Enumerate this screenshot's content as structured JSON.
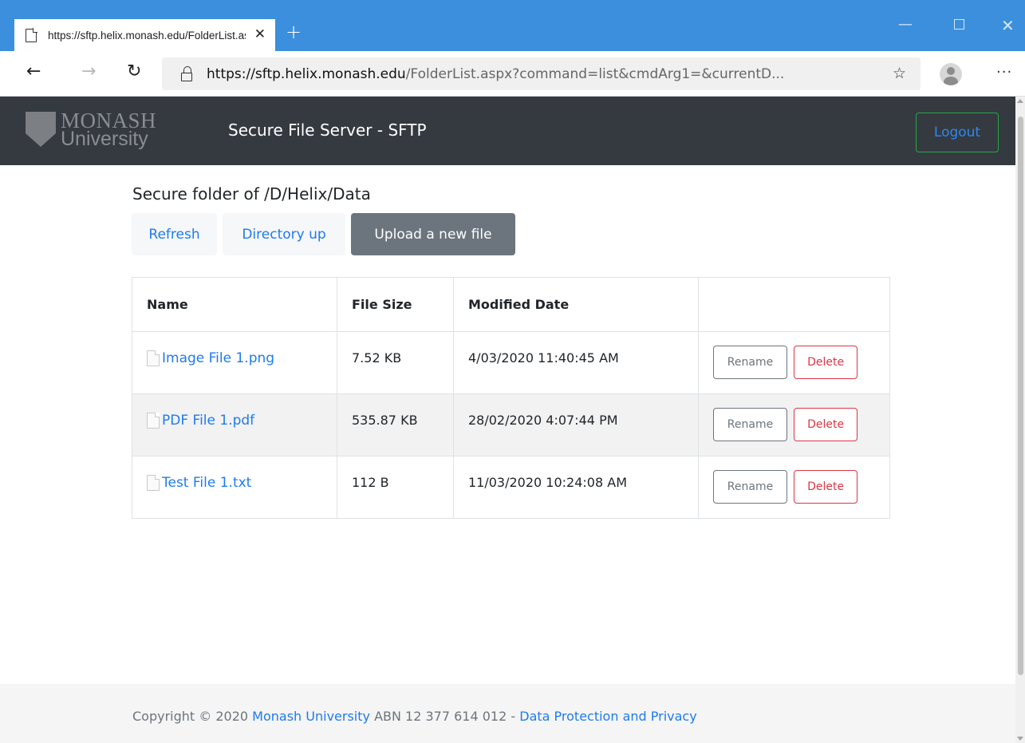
{
  "browser": {
    "tab_title": "https://sftp.helix.monash.edu/FolderList.aspx?",
    "tab_close": "✕",
    "new_tab": "+",
    "url_host": "https://sftp.helix.monash.edu",
    "url_path": "/FolderList.aspx?command=list&cmdArg1=&currentD...",
    "icons": {
      "back": "arrow-left-icon",
      "forward": "arrow-right-icon",
      "reload": "reload-icon",
      "lock": "lock-icon",
      "favorite": "star-icon",
      "profile": "profile-icon",
      "more": "more-icon"
    }
  },
  "navbar": {
    "logo_line1": "MONASH",
    "logo_line2": "University",
    "brand_title": "Secure File Server - SFTP",
    "logout_label": "Logout"
  },
  "main": {
    "heading": "Secure folder of /D/Helix/Data",
    "refresh_label": "Refresh",
    "directory_up_label": "Directory up",
    "upload_label": "Upload a new file"
  },
  "table": {
    "headers": {
      "name": "Name",
      "size": "File Size",
      "date": "Modified Date",
      "actions": ""
    },
    "rows": [
      {
        "name": "Image File 1.png",
        "size": "7.52 KB",
        "date": "4/03/2020 11:40:45 AM",
        "rename": "Rename",
        "delete": "Delete"
      },
      {
        "name": "PDF File 1.pdf",
        "size": "535.87 KB",
        "date": "28/02/2020 4:07:44 PM",
        "rename": "Rename",
        "delete": "Delete"
      },
      {
        "name": "Test File 1.txt",
        "size": "112 B",
        "date": "11/03/2020 10:24:08 AM",
        "rename": "Rename",
        "delete": "Delete"
      }
    ]
  },
  "footer": {
    "copyright_prefix": "Copyright © 2020",
    "org_link": "Monash University",
    "abn": "ABN 12 377 614 012 -",
    "privacy_link": "Data Protection and Privacy"
  },
  "colors": {
    "titlebar": "#3c8fdd",
    "navbar": "#343a40",
    "link": "#1e7bf0",
    "logout_border": "#28a745",
    "upload_button": "#6c757d",
    "delete": "#dc3545"
  }
}
